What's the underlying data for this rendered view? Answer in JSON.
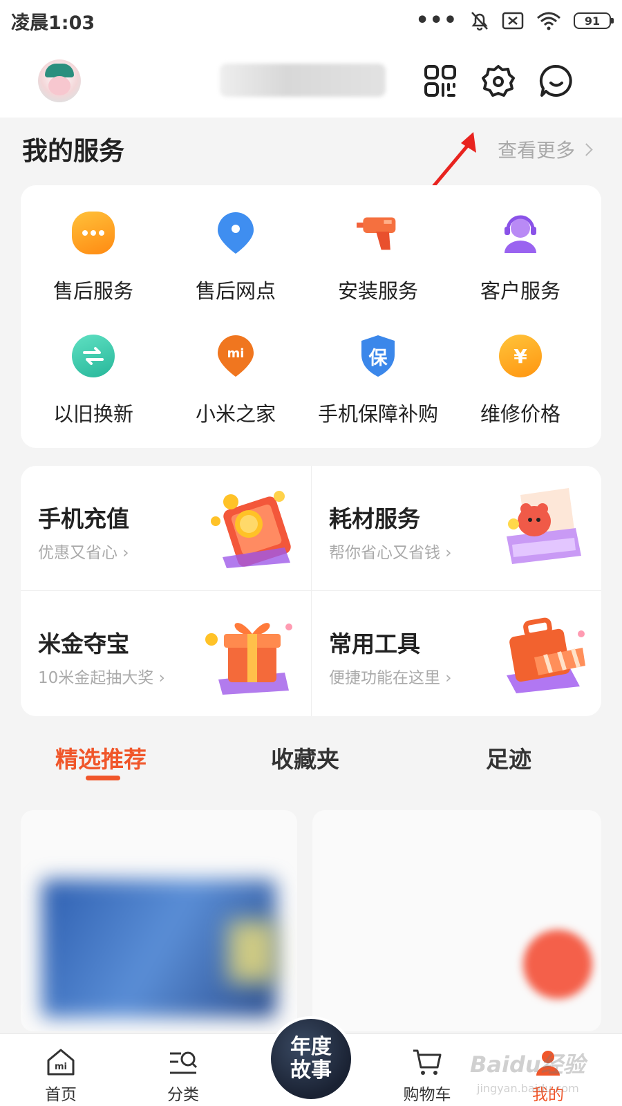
{
  "status_bar": {
    "time": "凌晨1:03",
    "battery": "91"
  },
  "header": {
    "icons": [
      "qrcode-icon",
      "settings-icon",
      "message-icon"
    ]
  },
  "my_services": {
    "title": "我的服务",
    "more_label": "查看更多",
    "items": [
      {
        "label": "售后服务",
        "icon": "chat-bubble-icon",
        "color": "#ffa41a"
      },
      {
        "label": "售后网点",
        "icon": "location-pin-icon",
        "color": "#3f8ef0"
      },
      {
        "label": "安装服务",
        "icon": "drill-icon",
        "color": "#f2613a"
      },
      {
        "label": "客户服务",
        "icon": "headset-agent-icon",
        "color": "#9a63f0"
      },
      {
        "label": "以旧换新",
        "icon": "exchange-icon",
        "color": "#3ccfb0"
      },
      {
        "label": "小米之家",
        "icon": "mi-store-pin-icon",
        "color": "#f0761f"
      },
      {
        "label": "手机保障补购",
        "icon": "shield-icon",
        "color": "#3b87ea",
        "glyph": "保"
      },
      {
        "label": "维修价格",
        "icon": "yuan-coin-icon",
        "color": "#ffa11b",
        "glyph": "¥"
      }
    ]
  },
  "promos": [
    {
      "title": "手机充值",
      "subtitle": "优惠又省心",
      "art": "coins-phone-art"
    },
    {
      "title": "耗材服务",
      "subtitle": "帮你省心又省钱",
      "art": "printer-mascot-art"
    },
    {
      "title": "米金夺宝",
      "subtitle": "10米金起抽大奖",
      "art": "gift-box-art"
    },
    {
      "title": "常用工具",
      "subtitle": "便捷功能在这里",
      "art": "toolbox-art"
    }
  ],
  "tabs": [
    {
      "label": "精选推荐",
      "active": true
    },
    {
      "label": "收藏夹",
      "active": false
    },
    {
      "label": "足迹",
      "active": false
    }
  ],
  "bottom_nav": {
    "items": [
      {
        "label": "首页",
        "icon": "mi-home-icon"
      },
      {
        "label": "分类",
        "icon": "category-search-icon"
      },
      {
        "label": "购物车",
        "icon": "cart-icon"
      },
      {
        "label": "我的",
        "icon": "profile-icon",
        "active": true
      }
    ],
    "center_label": "年度故事"
  },
  "watermark": {
    "main": "Baidu经验",
    "sub": "jingyan.baidu.com"
  },
  "colors": {
    "accent": "#f0562a",
    "card": "#ffffff",
    "background": "#f4f4f4"
  }
}
